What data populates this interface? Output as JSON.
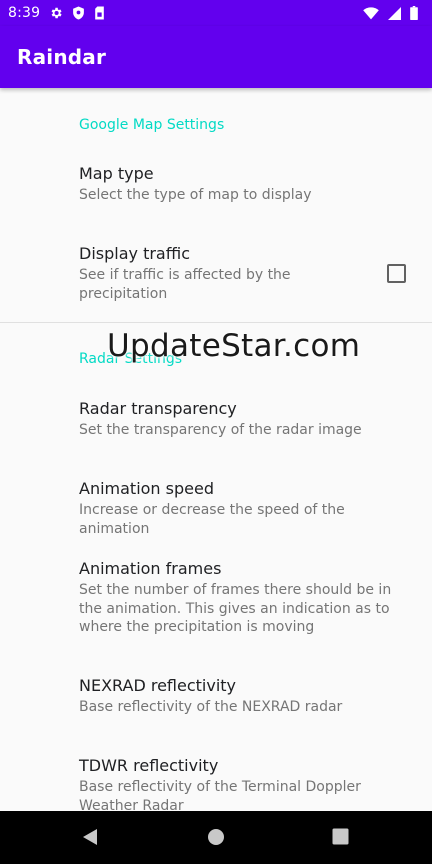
{
  "status_bar": {
    "time": "8:39",
    "left_icons": [
      "gear-icon",
      "shield-icon",
      "sim-card-icon"
    ],
    "right_icons": [
      "wifi-icon",
      "signal-icon",
      "battery-icon"
    ]
  },
  "app_bar": {
    "title": "Raindar"
  },
  "colors": {
    "primary": "#6200ee",
    "accent": "#03dac5"
  },
  "settings": {
    "google_map": {
      "header": "Google Map Settings",
      "map_type": {
        "title": "Map type",
        "summary": "Select the type of map to display"
      },
      "display_traffic": {
        "title": "Display traffic",
        "summary": "See if traffic is affected by the precipitation",
        "checked": false
      }
    },
    "radar": {
      "header": "Radar Settings",
      "transparency": {
        "title": "Radar transparency",
        "summary": "Set the transparency of the radar image"
      },
      "animation_speed": {
        "title": "Animation speed",
        "summary": "Increase or decrease the speed of the animation"
      },
      "animation_frames": {
        "title": "Animation frames",
        "summary": "Set the number of frames there should be in the animation. This gives an indication as to where the precipitation is moving"
      },
      "nexrad": {
        "title": "NEXRAD reflectivity",
        "summary": "Base reflectivity of the NEXRAD radar"
      },
      "tdwr": {
        "title": "TDWR reflectivity",
        "summary": "Base reflectivity of the Terminal Doppler Weather Radar"
      }
    }
  },
  "watermark": "UpdateStar.com",
  "nav_bar": {
    "buttons": [
      "back-icon",
      "home-icon",
      "recents-icon"
    ]
  }
}
